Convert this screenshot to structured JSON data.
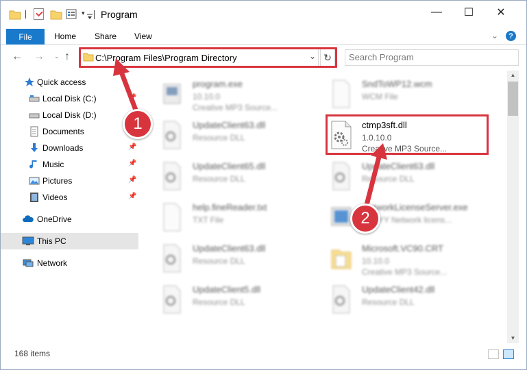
{
  "window": {
    "title": "Program",
    "controls": {
      "minimize": "—",
      "maximize": "☐",
      "close": "✕"
    }
  },
  "ribbon": {
    "tabs": [
      "File",
      "Home",
      "Share",
      "View"
    ],
    "help": "?"
  },
  "nav": {
    "address": "C:\\Program Files\\Program Directory",
    "search_placeholder": "Search Program"
  },
  "sidebar": {
    "items": [
      {
        "label": "Quick access",
        "icon": "star-icon",
        "pinned": false
      },
      {
        "label": "Local Disk (C:)",
        "icon": "drive-icon",
        "pinned": true
      },
      {
        "label": "Local Disk (D:)",
        "icon": "drive-icon",
        "pinned": false
      },
      {
        "label": "Documents",
        "icon": "documents-icon",
        "pinned": true
      },
      {
        "label": "Downloads",
        "icon": "download-icon",
        "pinned": true
      },
      {
        "label": "Music",
        "icon": "music-icon",
        "pinned": true
      },
      {
        "label": "Pictures",
        "icon": "pictures-icon",
        "pinned": true
      },
      {
        "label": "Videos",
        "icon": "videos-icon",
        "pinned": true
      },
      {
        "label": "OneDrive",
        "icon": "cloud-icon",
        "pinned": false
      },
      {
        "label": "This PC",
        "icon": "computer-icon",
        "pinned": false
      },
      {
        "label": "Network",
        "icon": "network-icon",
        "pinned": false
      }
    ]
  },
  "files": [
    {
      "name": "program.exe",
      "line2": "10.10.0",
      "line3": "Creative MP3 Source...",
      "icon": "exe-icon",
      "focus": false
    },
    {
      "name": "SndToWP12.wcm",
      "line2": "WCM File",
      "line3": "",
      "icon": "blank-file-icon",
      "focus": false
    },
    {
      "name": "UpdateClient63.dll",
      "line2": "Resource DLL",
      "line3": "",
      "icon": "dll-icon",
      "focus": false
    },
    {
      "name": "ctmp3sft.dll",
      "line2": "1.0.10.0",
      "line3": "Creative MP3 Source...",
      "icon": "dll-icon",
      "focus": true
    },
    {
      "name": "UpdateClient65.dll",
      "line2": "Resource DLL",
      "line3": "",
      "icon": "dll-icon",
      "focus": false
    },
    {
      "name": "UpdateClient63.dll",
      "line2": "Resource DLL",
      "line3": "",
      "icon": "dll-icon",
      "focus": false
    },
    {
      "name": "help.fineReader.txt",
      "line2": "TXT File",
      "line3": "",
      "icon": "blank-file-icon",
      "focus": false
    },
    {
      "name": "NetworkLicenseServer.exe",
      "line2": "ABBYY Network licens...",
      "line3": "",
      "icon": "exe-icon",
      "focus": false
    },
    {
      "name": "UpdateClient63.dll",
      "line2": "Resource DLL",
      "line3": "",
      "icon": "dll-icon",
      "focus": false
    },
    {
      "name": "Microsoft.VC90.CRT",
      "line2": "10.10.0",
      "line3": "Creative MP3 Source...",
      "icon": "folder-icon",
      "focus": false
    },
    {
      "name": "UpdateClient5.dll",
      "line2": "Resource DLL",
      "line3": "",
      "icon": "dll-icon",
      "focus": false
    },
    {
      "name": "UpdateClient42.dll",
      "line2": "Resource DLL",
      "line3": "",
      "icon": "dll-icon",
      "focus": false
    }
  ],
  "status": {
    "count": "168 items"
  },
  "callouts": [
    "1",
    "2"
  ],
  "colors": {
    "accent": "#1979ca",
    "highlight": "#d8343e",
    "selected": "#cce8ff"
  }
}
